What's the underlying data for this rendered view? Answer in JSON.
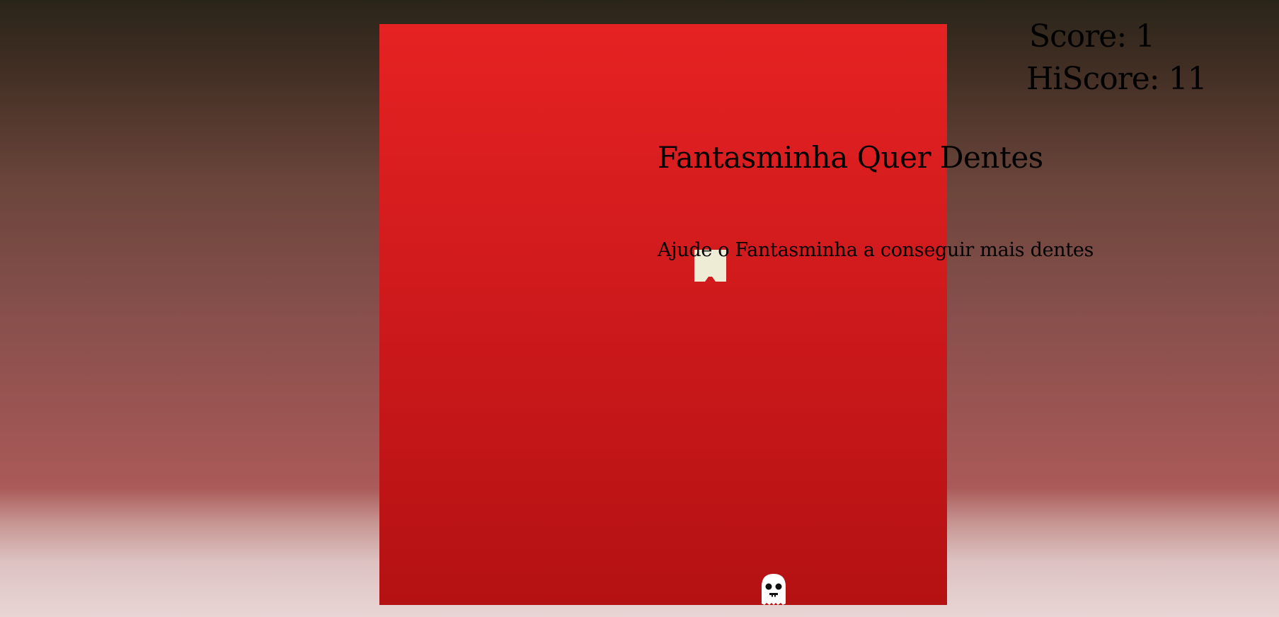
{
  "game": {
    "title": "Fantasminha Quer Dentes",
    "subtitle": "Ajude o Fantasminha a conseguir mais dentes"
  },
  "scoreboard": {
    "score_text": "Score: 1",
    "hiscore_text": "HiScore: 11",
    "score": 1,
    "hiscore": 11
  },
  "sprites": {
    "tooth_icon": "tooth-icon",
    "ghost_icon": "ghost-icon"
  },
  "colors": {
    "board_top": "#e62222",
    "board_bottom": "#b41113",
    "tooth": "#efecd6",
    "ghost": "#ffffff",
    "text": "#000000"
  }
}
